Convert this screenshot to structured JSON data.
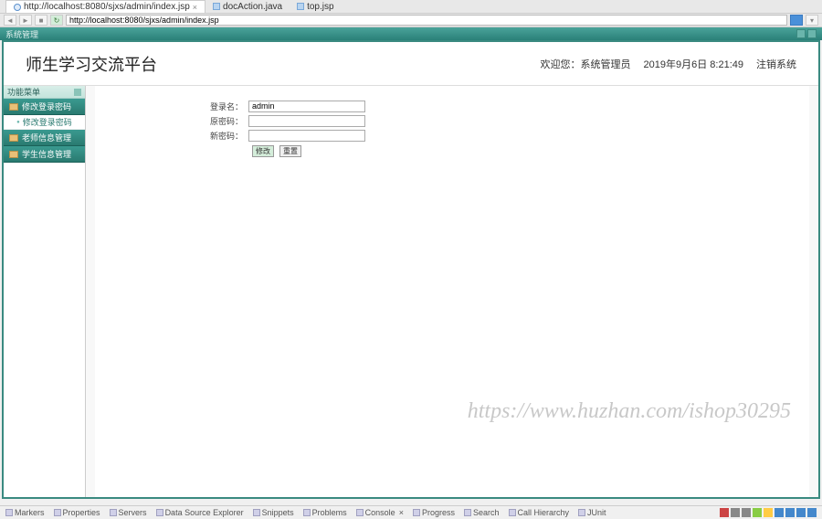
{
  "ide": {
    "tabs": [
      {
        "label": "http://localhost:8080/sjxs/admin/index.jsp",
        "icon": "globe"
      },
      {
        "label": "docAction.java",
        "icon": "java"
      },
      {
        "label": "top.jsp",
        "icon": "java"
      }
    ],
    "url": "http://localhost:8080/sjxs/admin/index.jsp",
    "bottom_views": [
      "Markers",
      "Properties",
      "Servers",
      "Data Source Explorer",
      "Snippets",
      "Problems",
      "Console",
      "Progress",
      "Search",
      "Call Hierarchy",
      "JUnit"
    ]
  },
  "win_title": "系统管理",
  "app": {
    "title": "师生学习交流平台",
    "welcome": {
      "greet": "欢迎您：",
      "role": "系统管理员",
      "datetime": "2019年9月6日 8:21:49",
      "logout": "注销系统"
    }
  },
  "sidebar": {
    "header": "功能菜单",
    "items": [
      {
        "label": "修改登录密码",
        "type": "item"
      },
      {
        "label": "修改登录密码",
        "type": "sub"
      },
      {
        "label": "老师信息管理",
        "type": "item"
      },
      {
        "label": "学生信息管理",
        "type": "item"
      }
    ]
  },
  "form": {
    "username_label": "登录名：",
    "username_value": "admin",
    "oldpw_label": "原密码：",
    "newpw_label": "新密码：",
    "submit": "修改",
    "reset": "重置"
  },
  "watermark": "https://www.huzhan.com/ishop30295"
}
